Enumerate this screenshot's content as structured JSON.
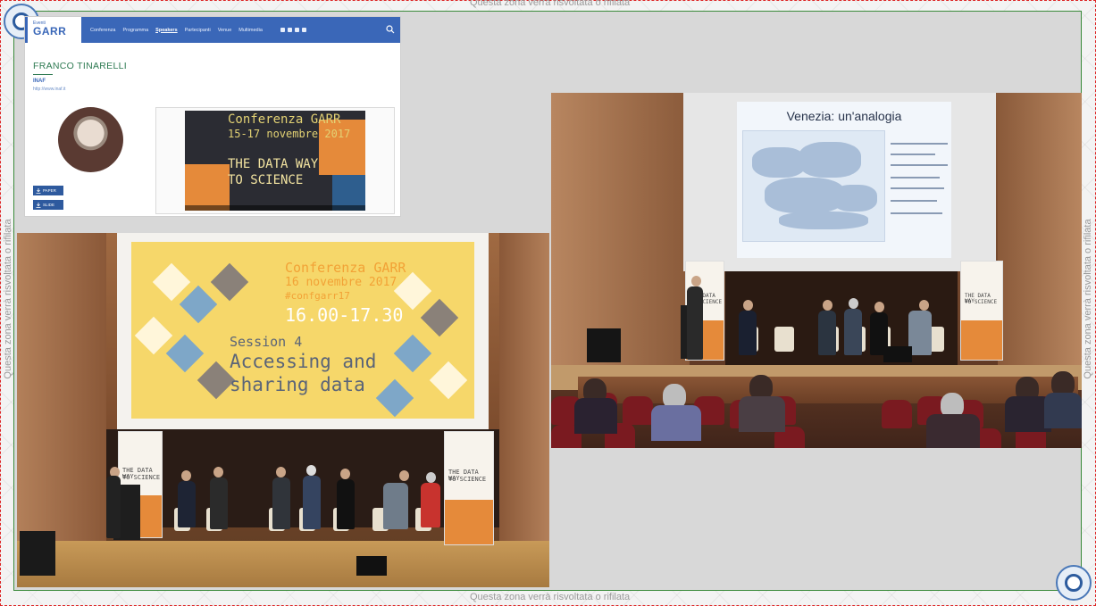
{
  "bleed_notes": {
    "top": "Questa zona verrà risvoltata o rifilata",
    "bottom": "Questa zona verrà risvoltata o rifilata",
    "left": "Questa zona verrà risvoltata o rifilata",
    "right": "Questa zona verrà risvoltata o rifilata"
  },
  "website": {
    "logo_sub": "Eventi",
    "logo_main": "GARR",
    "nav": [
      "Conferenza",
      "Programma",
      "Speakers",
      "Partecipanti",
      "Venue",
      "Multimedia"
    ],
    "nav_active": "Speakers",
    "speaker_name": "FRANCO TINARELLI",
    "affiliation": "INAF",
    "url": "http://www.inaf.it",
    "papers_button": "PAPER",
    "slide_button": "SLIDE",
    "video": {
      "line1": "Conferenza GARR",
      "line2": "15-17 novembre 2017",
      "line3": "THE DATA WAY",
      "line4": "TO SCIENCE"
    }
  },
  "photo_left": {
    "slide": {
      "conf": "Conferenza GARR",
      "date": "16 novembre 2017",
      "hashtag": "#confgarr17",
      "time": "16.00-17.30",
      "session": "Session 4",
      "title1": "Accessing and",
      "title2": "sharing data"
    },
    "banner_text": [
      "THE DATA WAY",
      "TO SCIENCE"
    ]
  },
  "photo_right": {
    "slide_title": "Venezia: un'analogia",
    "banner_text": [
      "THE DATA WAY",
      "TO SCIENCE"
    ]
  },
  "colors": {
    "garr_blue": "#3a67b8",
    "speaker_green": "#2e7a52",
    "slide_yellow": "#f6d76a",
    "accent_orange": "#e58a3a"
  }
}
